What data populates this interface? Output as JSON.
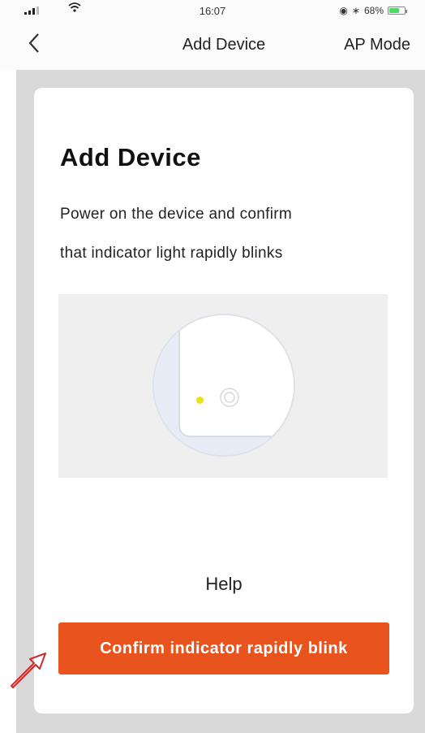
{
  "status_bar": {
    "time": "16:07",
    "battery_percent": "68%",
    "battery_level": 0.68,
    "icons": [
      "signal-icon",
      "wifi-icon",
      "alarm-icon",
      "bluetooth-icon",
      "battery-icon"
    ]
  },
  "nav": {
    "title": "Add Device",
    "mode_label": "AP Mode",
    "back_glyph": "‹"
  },
  "card": {
    "title": "Add Device",
    "description_line1": "Power on the device and confirm",
    "description_line2": "that indicator light rapidly blinks"
  },
  "help_label": "Help",
  "confirm_label": "Confirm indicator rapidly blink",
  "colors": {
    "accent": "#e9531d",
    "led": "#e9e11b",
    "backdrop": "#d9d9d9",
    "pointer_arrow": "#d12a2a"
  }
}
